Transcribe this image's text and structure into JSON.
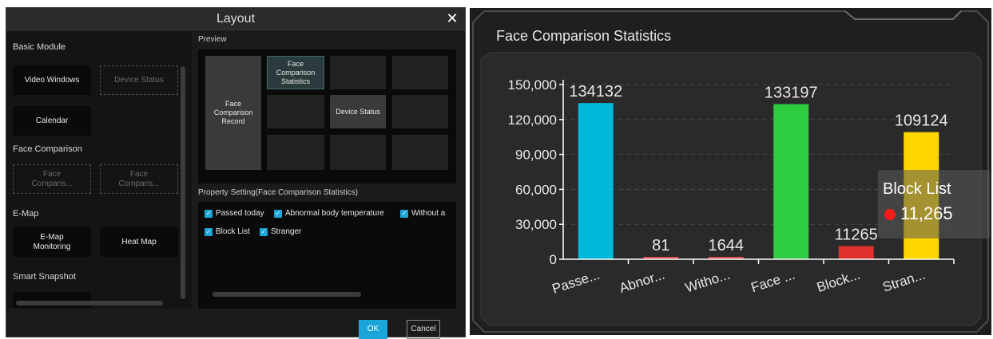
{
  "dialog": {
    "title": "Layout",
    "close_icon": "close-icon",
    "sections": {
      "basic": "Basic Module",
      "face": "Face Comparison",
      "emap": "E-Map",
      "smart": "Smart Snapshot"
    },
    "modules": {
      "video_windows": "Video Windows",
      "device_status": "Device Status",
      "calendar": "Calendar",
      "face_1": "Face\nComparis...",
      "face_2": "Face\nComparis...",
      "emap_monitoring": "E-Map\nMonitoring",
      "heat_map": "Heat Map"
    },
    "preview_label": "Preview",
    "preview": {
      "face_record": "Face\nComparison\nRecord",
      "face_stats": "Face\nComparison\nStatistics",
      "device_status": "Device Status"
    },
    "property_label": "Property Setting(Face Comparison Statistics)",
    "checkboxes": {
      "passed": "Passed today",
      "abnormal": "Abnormal body temperature",
      "without": "Without a",
      "blocklist": "Block List",
      "stranger": "Stranger"
    },
    "ok_label": "OK",
    "cancel_label": "Cancel"
  },
  "stats": {
    "title": "Face Comparison Statistics",
    "tooltip": {
      "title": "Block List",
      "value": "11,265",
      "dot_color": "#ff1a1a"
    }
  },
  "chart_data": {
    "type": "bar",
    "categories": [
      "Passe...",
      "Abnor...",
      "Witho...",
      "Face ...",
      "Block...",
      "Stran..."
    ],
    "values": [
      134132,
      81,
      1644,
      133197,
      11265,
      109124
    ],
    "value_labels": [
      "134132",
      "81",
      "1644",
      "133197",
      "11265",
      "109124"
    ],
    "colors": [
      "#00b8d9",
      "#e05050",
      "#e05050",
      "#2ecc40",
      "#e03030",
      "#ffd700"
    ],
    "yticks": [
      "0",
      "30,000",
      "60,000",
      "90,000",
      "120,000",
      "150,000"
    ],
    "ylim": [
      0,
      150000
    ],
    "grid": true,
    "xlabel": "",
    "ylabel": ""
  }
}
